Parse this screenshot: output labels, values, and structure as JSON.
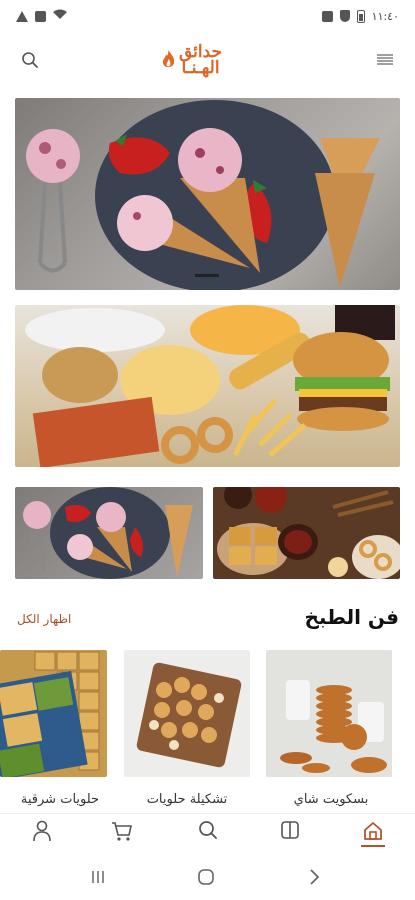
{
  "status_bar": {
    "time": "١١:٤٠",
    "icons": [
      "triangle-alert-icon",
      "lock-icon",
      "wifi-icon",
      "battery-icon",
      "shield-icon",
      "notification-icon"
    ]
  },
  "header": {
    "logo_line1": "حدائق",
    "logo_line2": "الهـنـا",
    "left_icon": "search-icon",
    "right_icon": "menu-icon",
    "accent": "#d9672a"
  },
  "banners": [
    {
      "name": "ice-cream-banner",
      "subject": "ice-cream-cones"
    },
    {
      "name": "fast-food-banner",
      "subject": "burger-fries-pizza"
    },
    {
      "name": "ice-cream-small",
      "subject": "ice-cream-cones"
    },
    {
      "name": "sweets-small",
      "subject": "oriental-sweets"
    }
  ],
  "section": {
    "title": "فن الطبخ",
    "show_all": "اظهار الكل",
    "accent": "#a0522d"
  },
  "cards": [
    {
      "label": "بسكويت شاي"
    },
    {
      "label": "تشكيلة حلويات"
    },
    {
      "label": "حلويات شرقية"
    }
  ],
  "bottom_nav": {
    "items": [
      "home-icon",
      "catalog-icon",
      "search-icon",
      "cart-icon",
      "user-icon"
    ],
    "active": "home-icon",
    "active_color": "#b5532a"
  }
}
